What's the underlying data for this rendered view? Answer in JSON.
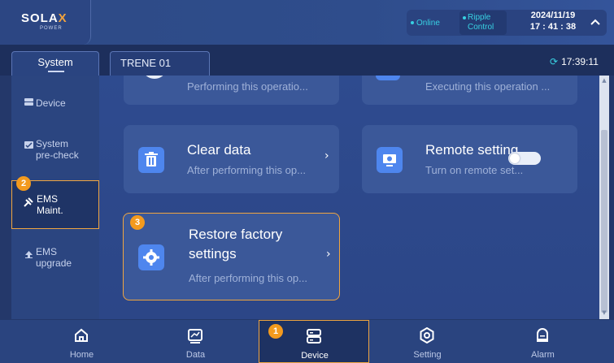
{
  "header": {
    "logo_main": "SOLA",
    "logo_x": "X",
    "logo_sub": "POWER",
    "status_online": "Online",
    "status_ripple": "Ripple Control",
    "date": "2024/11/19",
    "time": "17 : 41 : 38",
    "collapse_icon": "chevron-up-icon"
  },
  "tabs": {
    "system": "System",
    "device": "TRENE 01",
    "sync_time": "17:39:11"
  },
  "sidebar": {
    "items": [
      {
        "label": "Device",
        "icon": "device-icon"
      },
      {
        "label": "System\npre-check",
        "icon": "checklist-icon"
      },
      {
        "label": "EMS\nMaint.",
        "icon": "wrench-icon",
        "active": true,
        "badge": "2"
      },
      {
        "label": "EMS\nupgrade",
        "icon": "upload-icon"
      }
    ]
  },
  "cards": {
    "partial_left_desc": "Performing this operatio...",
    "partial_right_desc": "Executing this operation ...",
    "clear_data": {
      "title": "Clear data",
      "desc": "After performing this op..."
    },
    "remote_setting": {
      "title": "Remote setting",
      "desc": "Turn on remote set...",
      "toggle": "off"
    },
    "restore_factory": {
      "title_line1": "Restore factory",
      "title_line2": "settings",
      "desc": "After performing this op...",
      "badge": "3"
    }
  },
  "nav": {
    "items": [
      {
        "label": "Home",
        "icon": "home-icon"
      },
      {
        "label": "Data",
        "icon": "chart-icon"
      },
      {
        "label": "Device",
        "icon": "device-icon",
        "active": true,
        "badge": "1"
      },
      {
        "label": "Setting",
        "icon": "settings-icon"
      },
      {
        "label": "Alarm",
        "icon": "alarm-icon"
      }
    ]
  },
  "colors": {
    "accent_cyan": "#38d1e2",
    "highlight_orange": "#f0a540",
    "icon_blue": "#4e86ee",
    "background": "#24386a"
  }
}
